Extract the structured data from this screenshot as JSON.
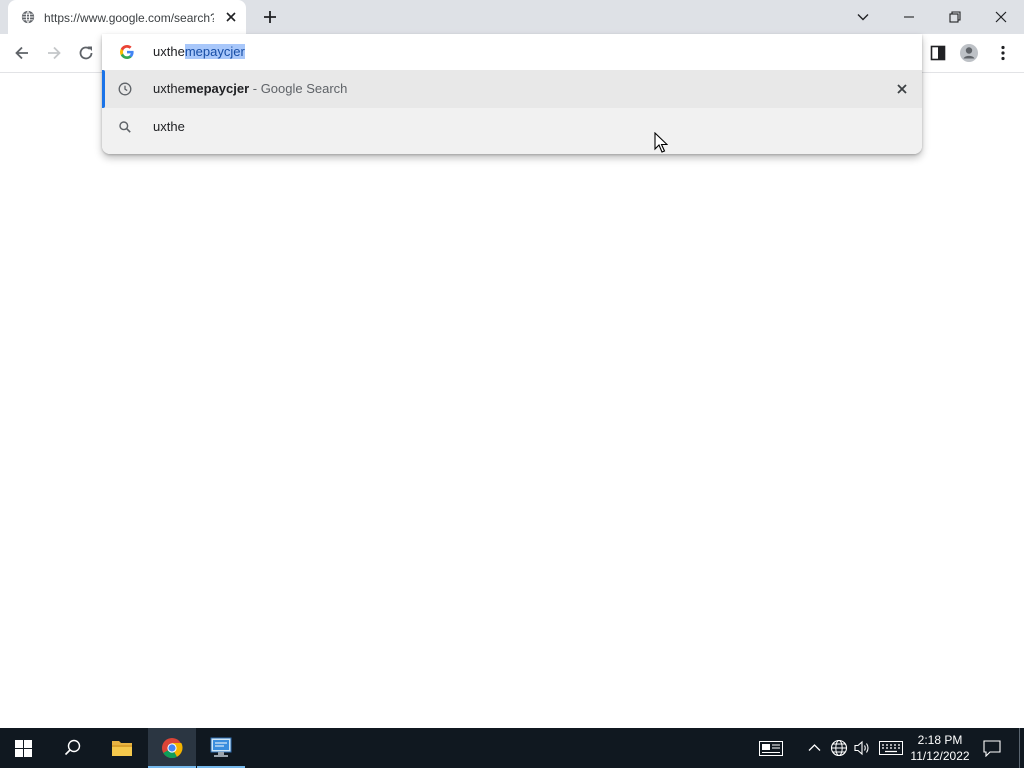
{
  "browser": {
    "tab": {
      "title": "https://www.google.com/search?",
      "favicon": "globe-icon"
    },
    "new_tab_icon": "plus-icon",
    "window_controls": [
      "chevron-down-icon",
      "minimize-icon",
      "restore-icon",
      "close-icon"
    ]
  },
  "toolbar": {
    "back_icon": "arrow-left-icon",
    "forward_icon": "arrow-right-icon",
    "reload_icon": "reload-icon",
    "side_panel_icon": "side-panel-icon",
    "profile_icon": "profile-icon",
    "menu_icon": "kebab-menu-icon"
  },
  "omnibox": {
    "typed_text": "uxthe",
    "autocomplete_selected": "mepaycjer",
    "search_engine_icon": "google-g-icon",
    "suggestions": [
      {
        "icon": "history-clock-icon",
        "prefix": "uxthe",
        "bold": "mepaycjer",
        "suffix": " - Google Search",
        "removable": true
      },
      {
        "icon": "search-icon",
        "prefix": "uxthe",
        "bold": "",
        "suffix": "",
        "removable": false
      }
    ]
  },
  "taskbar": {
    "items": [
      "windows-start-icon",
      "search-icon",
      "file-explorer-icon",
      "chrome-icon",
      "network-app-icon"
    ],
    "tray": [
      "news-icon",
      "chevron-up-icon",
      "network-globe-icon",
      "speaker-icon",
      "keyboard-icon"
    ],
    "time": "2:18 PM",
    "date": "11/12/2022",
    "notification_icon": "notification-icon"
  },
  "colors": {
    "tabstrip_bg": "#dee1e6",
    "accent": "#1a73e8",
    "selection": "#a8c7fa",
    "taskbar_bg": "#101820"
  }
}
